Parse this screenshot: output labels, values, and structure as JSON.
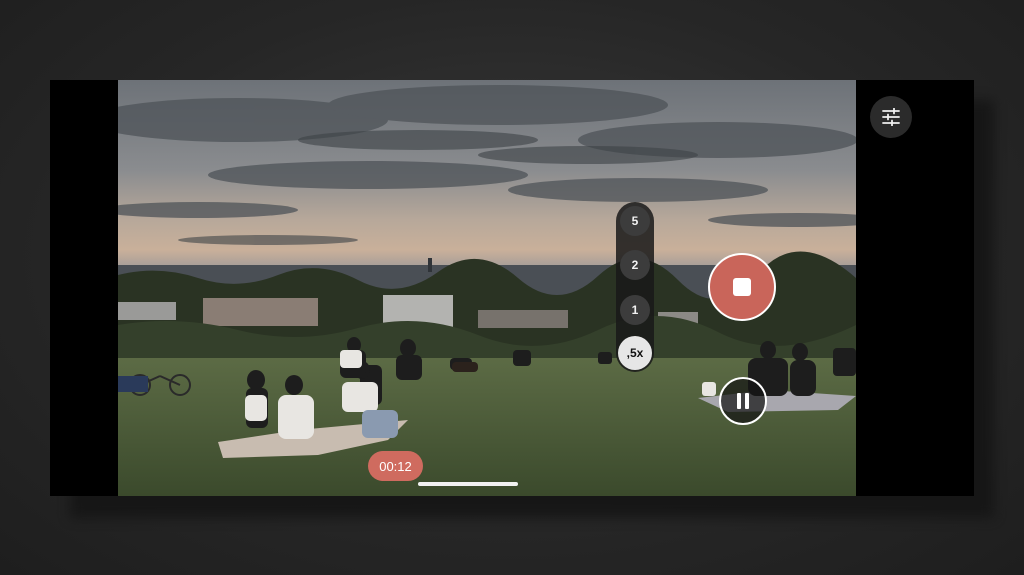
{
  "camera": {
    "zoom_levels": [
      "5",
      "2",
      "1",
      ",5x"
    ],
    "active_zoom": ",5x",
    "timer": "00:12",
    "record_state": "recording",
    "icons": {
      "settings": "sliders-icon",
      "record": "stop-icon",
      "pause": "pause-icon"
    },
    "colors": {
      "record": "#c9655a",
      "timer_badge": "#cf6b5f"
    }
  }
}
